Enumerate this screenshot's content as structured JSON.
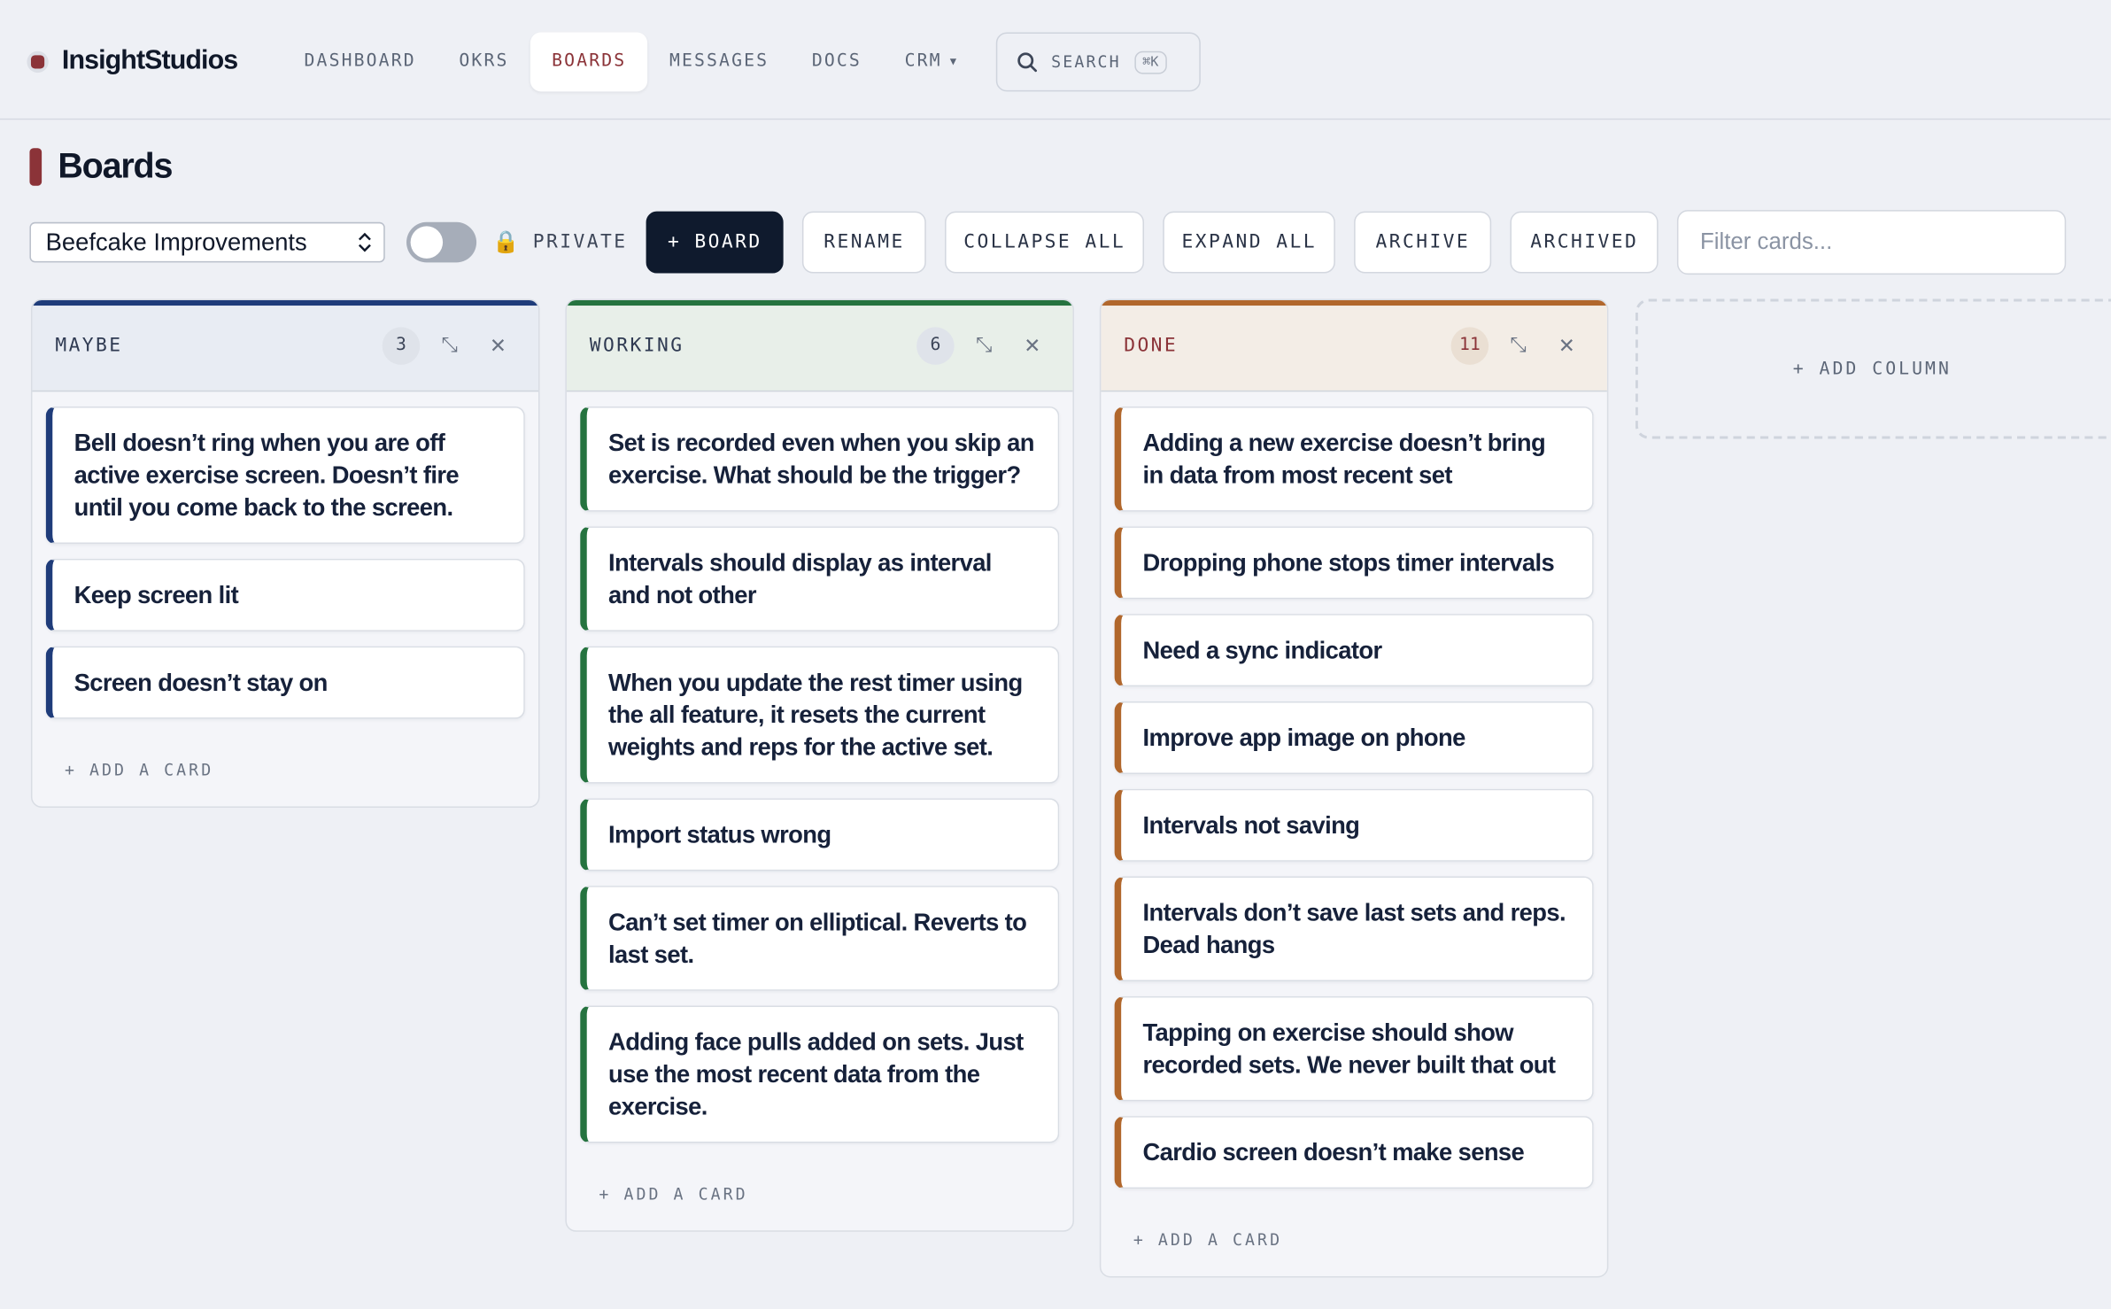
{
  "brand": {
    "name": "InsightStudios",
    "accent": "#8b3338"
  },
  "nav": {
    "items": [
      {
        "label": "DASHBOARD"
      },
      {
        "label": "OKRS"
      },
      {
        "label": "BOARDS",
        "active": true
      },
      {
        "label": "MESSAGES"
      },
      {
        "label": "DOCS"
      },
      {
        "label": "CRM",
        "has_dropdown": true
      }
    ],
    "search": {
      "label": "SEARCH",
      "shortcut": "⌘K"
    }
  },
  "page": {
    "title": "Boards"
  },
  "toolbar": {
    "board_select": "Beefcake Improvements",
    "private_toggle_on": false,
    "private_label": "PRIVATE",
    "new_board": "+ BOARD",
    "rename": "RENAME",
    "collapse_all": "COLLAPSE ALL",
    "expand_all": "EXPAND ALL",
    "archive": "ARCHIVE",
    "archived": "ARCHIVED",
    "filter_placeholder": "Filter cards..."
  },
  "columns": [
    {
      "title": "MAYBE",
      "count": "3",
      "color": "#1f3c7a",
      "cards": [
        "Bell doesn’t ring when you are off active exercise screen. Doesn’t fire until you come back to the screen.",
        "Keep screen lit",
        "Screen doesn’t stay on"
      ],
      "add_label": "+ ADD A CARD"
    },
    {
      "title": "WORKING",
      "count": "6",
      "color": "#25733f",
      "cards": [
        "Set is recorded even when you skip an exercise. What should be the trigger?",
        "Intervals should display as interval and not other",
        "When you update the rest timer using the all feature, it resets the current weights and reps for the active set.",
        "Import status wrong",
        "Can’t set timer on elliptical. Reverts to last set.",
        "Adding face pulls added on sets. Just use the most recent data from the exercise."
      ],
      "add_label": "+ ADD A CARD"
    },
    {
      "title": "DONE",
      "count": "11",
      "color": "#b1672c",
      "cards": [
        "Adding a new exercise doesn’t bring in data from most recent set",
        "Dropping phone stops timer intervals",
        "Need a sync indicator",
        "Improve app image on phone",
        "Intervals not saving",
        "Intervals don’t save last sets and reps. Dead hangs",
        "Tapping on exercise should show recorded sets. We never built that out",
        "Cardio screen doesn’t make sense"
      ],
      "add_label": "+ ADD A CARD"
    }
  ],
  "add_column": "+ ADD COLUMN"
}
